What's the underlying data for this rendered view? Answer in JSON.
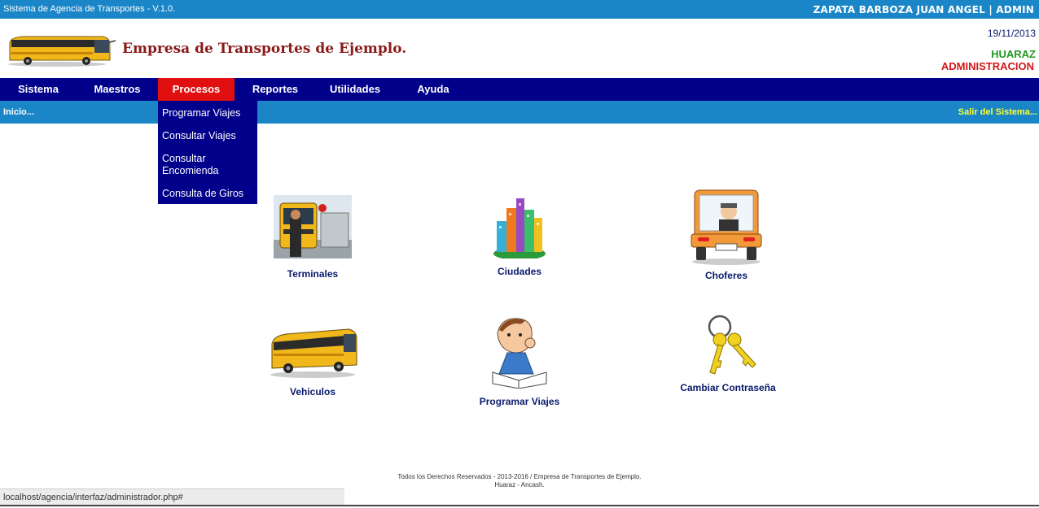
{
  "topbar": {
    "system_title": "Sistema de Agencia de Transportes - V.1.0.",
    "user": "ZAPATA BARBOZA JUAN ANGEL | ADMIN"
  },
  "header": {
    "company": "Empresa de Transportes de Ejemplo.",
    "date": "19/11/2013",
    "city": "HUARAZ",
    "role": "ADMINISTRACION"
  },
  "nav": {
    "items": [
      {
        "label": "Sistema"
      },
      {
        "label": "Maestros"
      },
      {
        "label": "Procesos"
      },
      {
        "label": "Reportes"
      },
      {
        "label": "Utilidades"
      },
      {
        "label": "Ayuda"
      }
    ],
    "active": "Procesos"
  },
  "breadcrumb": {
    "home": "Inicio...",
    "logout": "Salir del Sistema..."
  },
  "dropdown": {
    "items": [
      {
        "label": "Programar Viajes"
      },
      {
        "label": "Consultar Viajes"
      },
      {
        "label": "Consultar Encomienda"
      },
      {
        "label": "Consulta de Giros"
      }
    ]
  },
  "tiles": [
    {
      "label": "Terminales",
      "icon": "terminal-icon"
    },
    {
      "label": "Ciudades",
      "icon": "city-icon"
    },
    {
      "label": "Choferes",
      "icon": "driver-icon"
    },
    {
      "label": "Vehiculos",
      "icon": "bus-icon"
    },
    {
      "label": "Programar Viajes",
      "icon": "student-reading-icon"
    },
    {
      "label": "Cambiar Contraseña",
      "icon": "keys-icon"
    }
  ],
  "footer": {
    "line1": "Todos los Derechos Reservados - 2013-2016 / Empresa de Transportes de Ejemplo.",
    "line2": "Huaraz - Ancash."
  },
  "statusbar": {
    "url": "localhost/agencia/interfaz/administrador.php#"
  },
  "colors": {
    "topbar": "#1a86c8",
    "nav": "#00008b",
    "active": "#e01010",
    "company": "#8b1a1a",
    "city": "#229922",
    "role": "#d01818"
  }
}
